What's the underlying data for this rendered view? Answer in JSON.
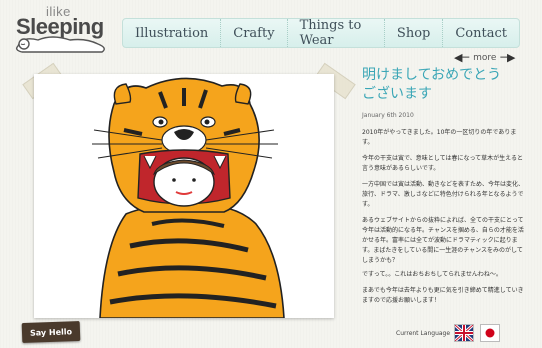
{
  "logo": {
    "small": "ilike",
    "big": "Sleeping"
  },
  "nav": {
    "items": [
      "Illustration",
      "Crafty",
      "Things to Wear",
      "Shop",
      "Contact"
    ]
  },
  "more": {
    "label": "more"
  },
  "post": {
    "title": "明けましておめでとうございます",
    "date": "January 6th 2010",
    "paragraphs": [
      "2010年がやってきました。10年の一区切りの年であります。",
      "今年の干支は寅で、意味としては春になって草木が生えると言う意味があるらしいです。",
      "一方中国では寅は活動、動きなどを表すため、今年は変化、旅行、ドラマ、激しさなどに特色付けられる年となるようです。",
      "あるウェブサイトからの抜粋によれば、全ての干支にとって今年は活動的になる年。チャンスを掴める、自らの才能を活かせる年。富率には全てが波動にドラマティックに起ります。まばたきをしている間に一生涯のチャンスをみのがしてしまうかも？",
      "ですって。。これはおちおちしてられませんわね〜。",
      "まあでも今年は去年よりも更に気を引き締めて精進していきますので応援お願いします！"
    ]
  },
  "footer": {
    "say_hello": "Say Hello",
    "current_language": "Current Language"
  },
  "icons": {
    "more_arrow": "double-arrow-icon",
    "uk": "uk-flag-icon",
    "jp": "japan-flag-icon"
  },
  "colors": {
    "accent": "#3aa6b6",
    "nav_bg": "#dcefec",
    "tiger_orange": "#f5a41c"
  }
}
